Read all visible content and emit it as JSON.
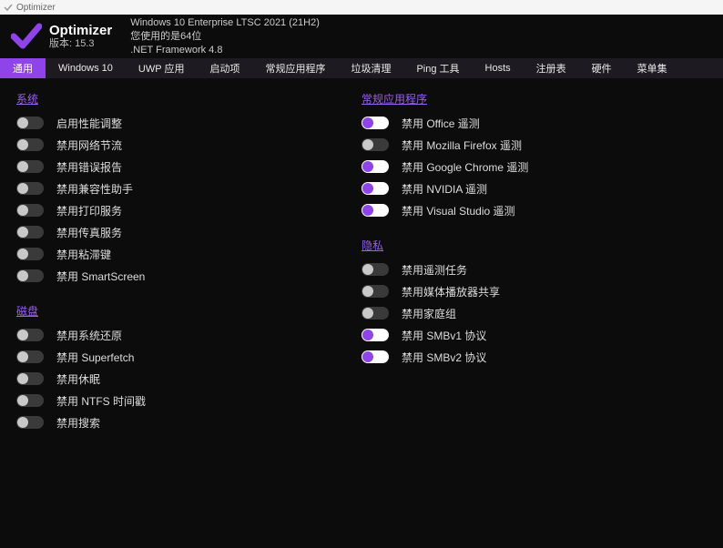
{
  "window_title": "Optimizer",
  "header": {
    "app_name": "Optimizer",
    "version_label": "版本: 15.3",
    "os_line": "Windows 10 Enterprise LTSC 2021 (21H2)",
    "arch_line": "您使用的是64位",
    "framework_line": ".NET Framework 4.8"
  },
  "tabs": [
    "通用",
    "Windows 10",
    "UWP 应用",
    "启动项",
    "常规应用程序",
    "垃圾清理",
    "Ping 工具",
    "Hosts",
    "注册表",
    "硬件",
    "菜单集"
  ],
  "active_tab_index": 0,
  "sections": {
    "left": [
      {
        "title": "系统",
        "items": [
          {
            "label": "启用性能调整",
            "on": false
          },
          {
            "label": "禁用网络节流",
            "on": false
          },
          {
            "label": "禁用错误报告",
            "on": false
          },
          {
            "label": "禁用兼容性助手",
            "on": false
          },
          {
            "label": "禁用打印服务",
            "on": false
          },
          {
            "label": "禁用传真服务",
            "on": false
          },
          {
            "label": "禁用粘滞键",
            "on": false
          },
          {
            "label": "禁用 SmartScreen",
            "on": false
          }
        ]
      },
      {
        "title": "磁盘",
        "items": [
          {
            "label": "禁用系统还原",
            "on": false
          },
          {
            "label": "禁用 Superfetch",
            "on": false
          },
          {
            "label": "禁用休眠",
            "on": false
          },
          {
            "label": "禁用 NTFS 时间戳",
            "on": false
          },
          {
            "label": "禁用搜索",
            "on": false
          }
        ]
      }
    ],
    "right": [
      {
        "title": "常规应用程序",
        "items": [
          {
            "label": "禁用 Office 遥测",
            "on": true
          },
          {
            "label": "禁用 Mozilla Firefox 遥测",
            "on": false
          },
          {
            "label": "禁用 Google Chrome 遥测",
            "on": true
          },
          {
            "label": "禁用 NVIDIA 遥测",
            "on": true
          },
          {
            "label": "禁用 Visual Studio 遥测",
            "on": true
          }
        ]
      },
      {
        "title": "隐私",
        "items": [
          {
            "label": "禁用遥测任务",
            "on": false
          },
          {
            "label": "禁用媒体播放器共享",
            "on": false
          },
          {
            "label": "禁用家庭组",
            "on": false
          },
          {
            "label": "禁用 SMBv1 协议",
            "on": true
          },
          {
            "label": "禁用 SMBv2 协议",
            "on": true
          }
        ]
      }
    ]
  },
  "colors": {
    "accent": "#8e44e8",
    "bg": "#0c0c0c"
  }
}
